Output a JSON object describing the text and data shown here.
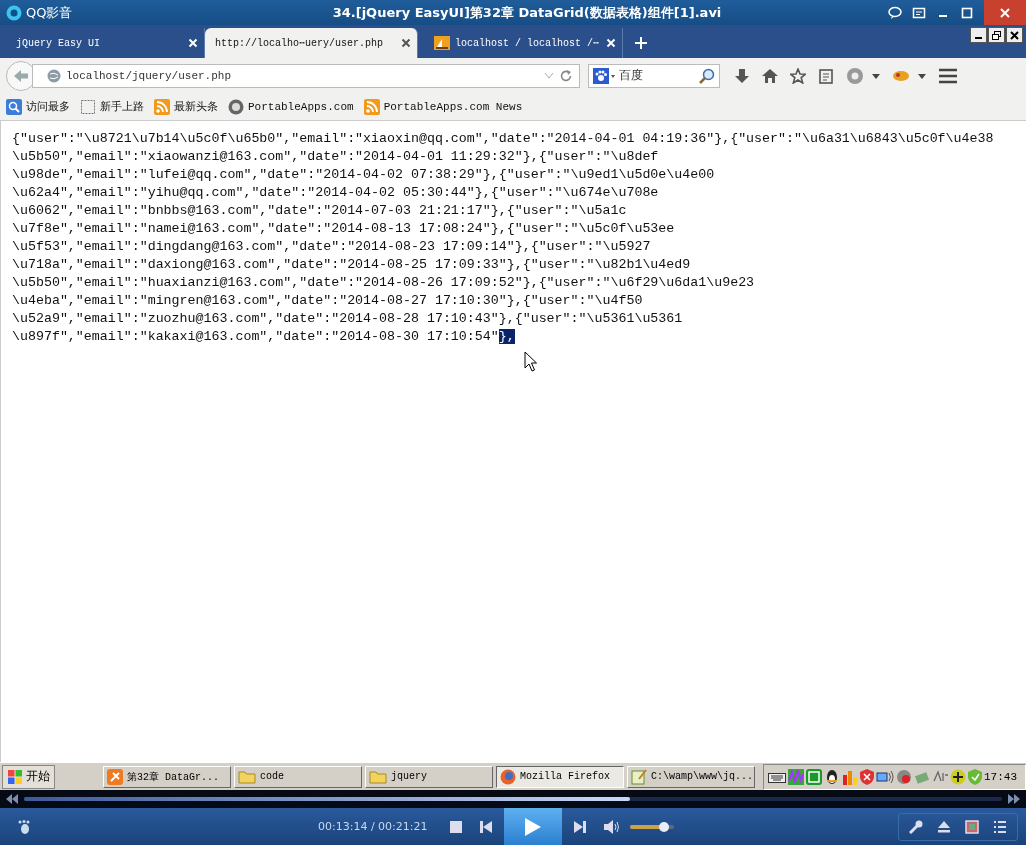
{
  "player": {
    "app_name": "QQ影音",
    "title": "34.[jQuery EasyUI]第32章 DataGrid(数据表格)组件[1].avi"
  },
  "browser": {
    "tabs": [
      {
        "label": "jQuery Easy UI",
        "selected": false,
        "kind": "plain"
      },
      {
        "label": "http://localho⋯uery/user.php",
        "selected": true,
        "kind": "plain"
      },
      {
        "label": "localhost / localhost /⋯",
        "selected": false,
        "kind": "pma"
      }
    ],
    "url": "localhost/jquery/user.php",
    "search_engine": "百度",
    "bookmarks": [
      {
        "label": "访问最多",
        "kind": "smart"
      },
      {
        "label": "新手上路",
        "kind": "page"
      },
      {
        "label": "最新头条",
        "kind": "feed"
      },
      {
        "label": "PortableApps.com",
        "kind": "globe"
      },
      {
        "label": "PortableApps.com News",
        "kind": "feed"
      }
    ]
  },
  "content": {
    "lines": [
      "{\"user\":\"\\u8721\\u7b14\\u5c0f\\u65b0\",\"email\":\"xiaoxin@qq.com\",\"date\":\"2014-04-01 04:19:36\"},{\"user\":\"\\u6a31\\u6843\\u5c0f\\u4e38",
      "\\u5b50\",\"email\":\"xiaowanzi@163.com\",\"date\":\"2014-04-01 11:29:32\"},{\"user\":\"\\u8def",
      "\\u98de\",\"email\":\"lufei@qq.com\",\"date\":\"2014-04-02 07:38:29\"},{\"user\":\"\\u9ed1\\u5d0e\\u4e00",
      "\\u62a4\",\"email\":\"yihu@qq.com\",\"date\":\"2014-04-02 05:30:44\"},{\"user\":\"\\u674e\\u708e",
      "\\u6062\",\"email\":\"bnbbs@163.com\",\"date\":\"2014-07-03 21:21:17\"},{\"user\":\"\\u5a1c",
      "\\u7f8e\",\"email\":\"namei@163.com\",\"date\":\"2014-08-13 17:08:24\"},{\"user\":\"\\u5c0f\\u53ee",
      "\\u5f53\",\"email\":\"dingdang@163.com\",\"date\":\"2014-08-23 17:09:14\"},{\"user\":\"\\u5927",
      "\\u718a\",\"email\":\"daxiong@163.com\",\"date\":\"2014-08-25 17:09:33\"},{\"user\":\"\\u82b1\\u4ed9",
      "\\u5b50\",\"email\":\"huaxianzi@163.com\",\"date\":\"2014-08-26 17:09:52\"},{\"user\":\"\\u6f29\\u6da1\\u9e23",
      "\\u4eba\",\"email\":\"mingren@163.com\",\"date\":\"2014-08-27 17:10:30\"},{\"user\":\"\\u4f50",
      "\\u52a9\",\"email\":\"zuozhu@163.com\",\"date\":\"2014-08-28 17:10:43\"},{\"user\":\"\\u5361\\u5361",
      "\\u897f\",\"email\":\"kakaxi@163.com\",\"date\":\"2014-08-30 17:10:54\""
    ],
    "selected_text": "},"
  },
  "taskbar": {
    "start_label": "开始",
    "tasks": [
      {
        "label": "第32章 DataGr...",
        "selected": false,
        "kind": "video"
      },
      {
        "label": "code",
        "selected": false,
        "kind": "folder"
      },
      {
        "label": "jquery",
        "selected": false,
        "kind": "folder"
      },
      {
        "label": "Mozilla Firefox",
        "selected": true,
        "kind": "firefox"
      },
      {
        "label": "C:\\wamp\\www\\jq...",
        "selected": false,
        "kind": "editor"
      }
    ],
    "clock": "17:43"
  },
  "controls": {
    "progress": {
      "level": 0.62
    },
    "time": "00:13:14 / 00:21:21",
    "volume": {
      "level": 0.9
    }
  }
}
